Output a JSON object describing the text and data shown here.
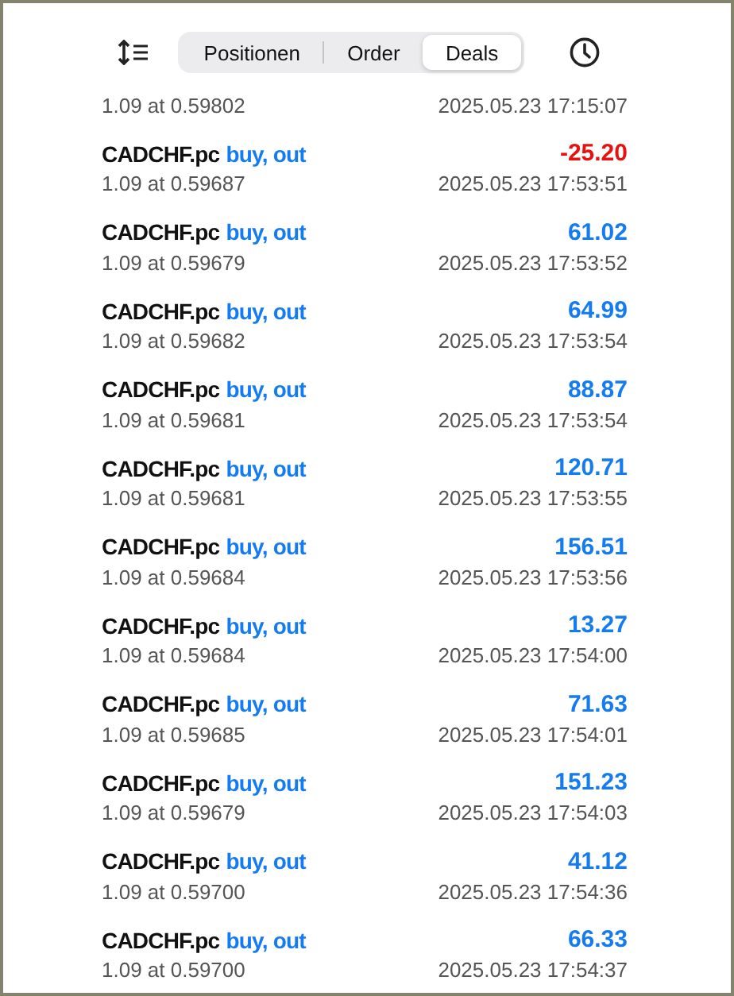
{
  "tabs": [
    {
      "label": "Positionen",
      "selected": false
    },
    {
      "label": "Order",
      "selected": false
    },
    {
      "label": "Deals",
      "selected": true
    }
  ],
  "deals": [
    {
      "volume_price": "1.09 at 0.59802",
      "time": "2025.05.23 17:15:07"
    },
    {
      "symbol": "CADCHF.pc",
      "side": "buy, out",
      "profit": "-25.20",
      "color": "#e8110f",
      "volume_price": "1.09 at 0.59687",
      "time": "2025.05.23 17:53:51"
    },
    {
      "symbol": "CADCHF.pc",
      "side": "buy, out",
      "profit": "61.02",
      "color": "#147cf0",
      "volume_price": "1.09 at 0.59679",
      "time": "2025.05.23 17:53:52"
    },
    {
      "symbol": "CADCHF.pc",
      "side": "buy, out",
      "profit": "64.99",
      "color": "#147cf0",
      "volume_price": "1.09 at 0.59682",
      "time": "2025.05.23 17:53:54"
    },
    {
      "symbol": "CADCHF.pc",
      "side": "buy, out",
      "profit": "88.87",
      "color": "#147cf0",
      "volume_price": "1.09 at 0.59681",
      "time": "2025.05.23 17:53:54"
    },
    {
      "symbol": "CADCHF.pc",
      "side": "buy, out",
      "profit": "120.71",
      "color": "#147cf0",
      "volume_price": "1.09 at 0.59681",
      "time": "2025.05.23 17:53:55"
    },
    {
      "symbol": "CADCHF.pc",
      "side": "buy, out",
      "profit": "156.51",
      "color": "#147cf0",
      "volume_price": "1.09 at 0.59684",
      "time": "2025.05.23 17:53:56"
    },
    {
      "symbol": "CADCHF.pc",
      "side": "buy, out",
      "profit": "13.27",
      "color": "#147cf0",
      "volume_price": "1.09 at 0.59684",
      "time": "2025.05.23 17:54:00"
    },
    {
      "symbol": "CADCHF.pc",
      "side": "buy, out",
      "profit": "71.63",
      "color": "#147cf0",
      "volume_price": "1.09 at 0.59685",
      "time": "2025.05.23 17:54:01"
    },
    {
      "symbol": "CADCHF.pc",
      "side": "buy, out",
      "profit": "151.23",
      "color": "#147cf0",
      "volume_price": "1.09 at 0.59679",
      "time": "2025.05.23 17:54:03"
    },
    {
      "symbol": "CADCHF.pc",
      "side": "buy, out",
      "profit": "41.12",
      "color": "#147cf0",
      "volume_price": "1.09 at 0.59700",
      "time": "2025.05.23 17:54:36"
    },
    {
      "symbol": "CADCHF.pc",
      "side": "buy, out",
      "profit": "66.33",
      "color": "#147cf0",
      "volume_price": "1.09 at 0.59700",
      "time": "2025.05.23 17:54:37"
    }
  ]
}
